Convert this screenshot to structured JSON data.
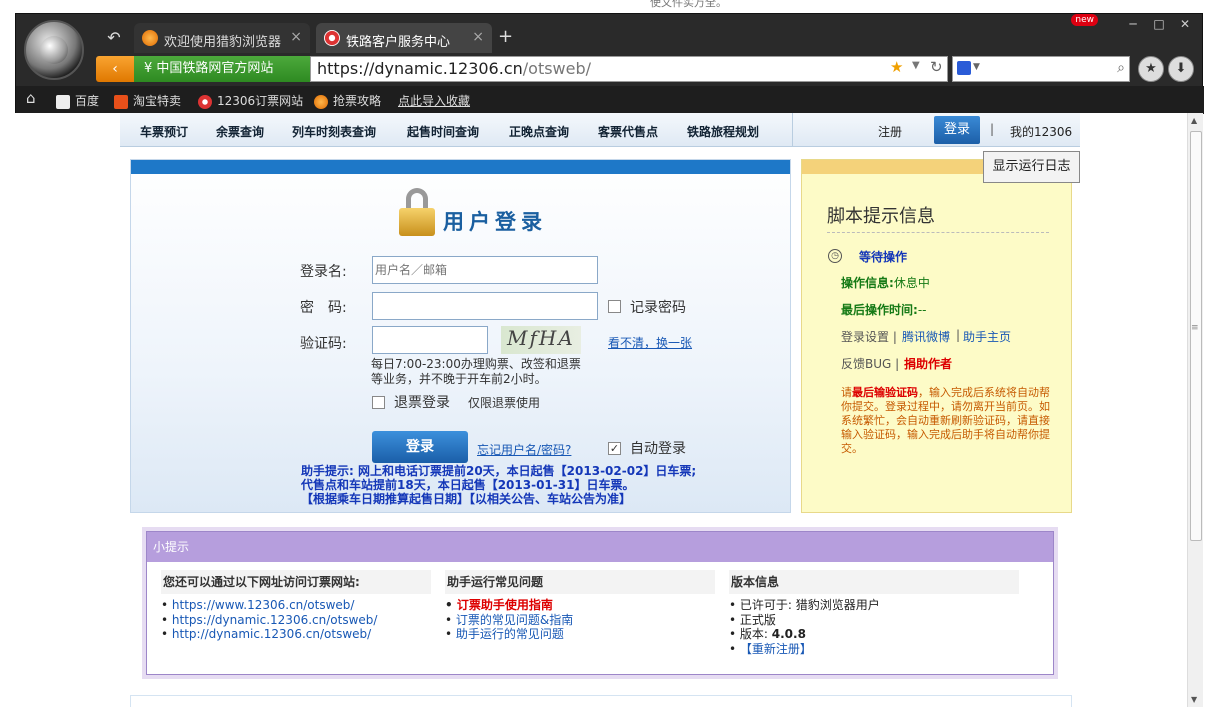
{
  "browser": {
    "top_caption": "使文件实万全。",
    "back_icon": "undo-arrow-icon",
    "tabs": [
      {
        "label": "欢迎使用猎豹浏览器",
        "close": "×"
      },
      {
        "label": "铁路客户服务中心",
        "close": "×"
      }
    ],
    "new_tab": "+",
    "new_badge": "new",
    "window_controls": [
      "─",
      "□",
      "✕"
    ],
    "site_badge": "¥ 中国铁路网官方网站",
    "url_host": "https://dynamic.12306.cn",
    "url_path": "/otsweb/",
    "bookmarks": [
      {
        "label": "百度",
        "icon": "page-icon"
      },
      {
        "label": "淘宝特卖",
        "icon": "taobao-icon"
      },
      {
        "label": "12306订票网站",
        "icon": "rail-icon"
      },
      {
        "label": "抢票攻略",
        "icon": "cheetah-icon"
      },
      {
        "label": "点此导入收藏",
        "icon": ""
      }
    ]
  },
  "site_nav": {
    "items": [
      "车票预订",
      "余票查询",
      "列车时刻表查询",
      "起售时间查询",
      "正晚点查询",
      "客票代售点",
      "铁路旅程规划"
    ],
    "register": "注册",
    "login": "登录",
    "separator": "|",
    "my": "我的12306"
  },
  "login": {
    "title": "用户登录",
    "username_label": "登录名:",
    "username_placeholder": "用户名／邮箱",
    "password_label": "密　码:",
    "remember_label": "记录密码",
    "captcha_label": "验证码:",
    "captcha_text": "MfHA",
    "refresh_captcha": "看不清，换一张",
    "hint": "每日7:00-23:00办理购票、改签和退票等业务，并不晚于开车前2小时。",
    "refund_login": "退票登录",
    "refund_only": "仅限退票使用",
    "login_button": "登录",
    "forgot": "忘记用户名/密码?",
    "auto_login": "自动登录",
    "helper_line1": "助手提示: 网上和电话订票提前20天，本日起售【2013-02-02】日车票;",
    "helper_line2": "代售点和车站提前18天，本日起售【2013-01-31】日车票。",
    "helper_line3": "【根据乘车日期推算起售日期】【以相关公告、车站公告为准】"
  },
  "script_info": {
    "title": "脚本提示信息",
    "wait": "等待操作",
    "op_info_label": "操作信息:",
    "op_info_value": "休息中",
    "last_op_label": "最后操作时间:",
    "last_op_value": "--",
    "login_settings": "登录设置 |",
    "weibo": "腾讯微博",
    "sep": "|",
    "homepage": "助手主页",
    "feedback": "反馈BUG |",
    "donate": "捐助作者",
    "note_prefix": "请",
    "note_bold": "最后输验证码",
    "note_rest": "，输入完成后系统将自动帮你提交。登录过程中，请勿离开当前页。如系统繁忙，会自动重新刷新验证码，请直接输入验证码，输入完成后助手将自动帮你提交。"
  },
  "show_log_button": "显示运行日志",
  "tips": {
    "header": "小提示",
    "col1_title": "您还可以通过以下网址访问订票网站:",
    "col1_items": [
      "https://www.12306.cn/otsweb/",
      "https://dynamic.12306.cn/otsweb/",
      "http://dynamic.12306.cn/otsweb/"
    ],
    "col2_title": "助手运行常见问题",
    "col2_items": [
      "订票助手使用指南",
      "订票的常见问题&指南",
      "助手运行的常见问题"
    ],
    "col3_title": "版本信息",
    "col3_allowed": "已许可于: 猎豹浏览器用户",
    "col3_formal": "正式版",
    "col3_version_label": "版本: ",
    "col3_version": "4.0.8",
    "col3_reregister": "【重新注册】"
  },
  "colors": {
    "site_blue": "#1e78c8",
    "script_yellow": "#fdfbc7",
    "tips_purple": "#b69edd",
    "helper_blue": "#1437b8"
  }
}
